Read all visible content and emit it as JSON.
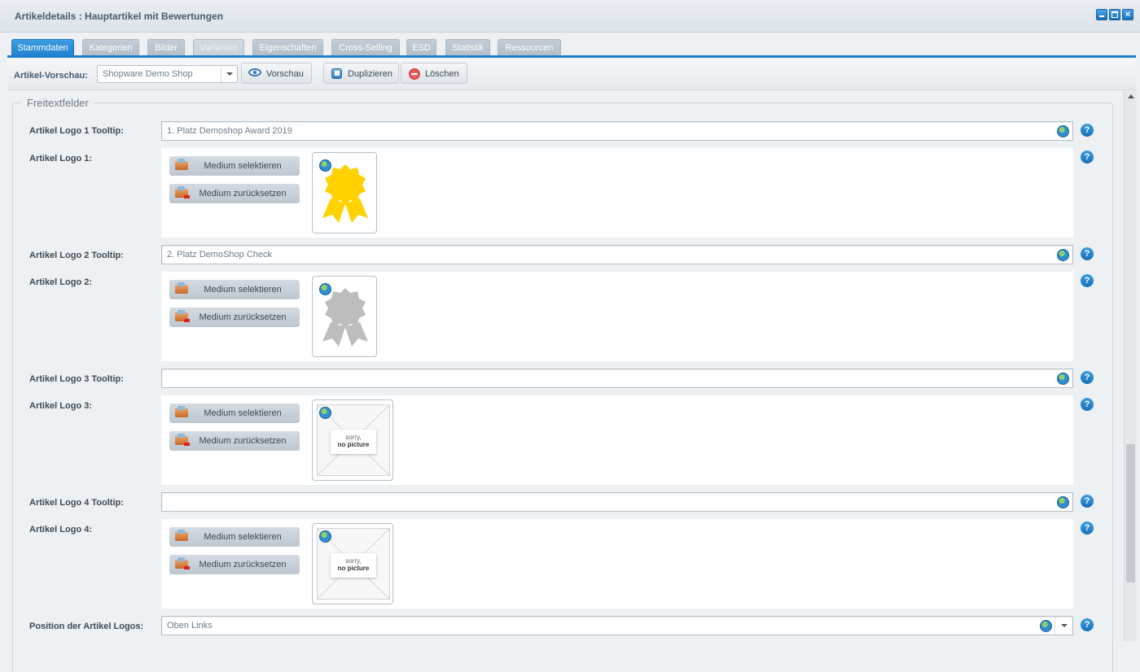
{
  "window": {
    "title": "Artikeldetails : Hauptartikel mit Bewertungen"
  },
  "tabs": [
    {
      "label": "Stammdaten",
      "state": "active"
    },
    {
      "label": "Kategorien",
      "state": "normal"
    },
    {
      "label": "Bilder",
      "state": "normal"
    },
    {
      "label": "Varianten",
      "state": "disabled"
    },
    {
      "label": "Eigenschaften",
      "state": "normal"
    },
    {
      "label": "Cross-Selling",
      "state": "normal"
    },
    {
      "label": "ESD",
      "state": "normal"
    },
    {
      "label": "Statistik",
      "state": "normal"
    },
    {
      "label": "Ressourcen",
      "state": "normal"
    }
  ],
  "toolbar": {
    "preview_label": "Artikel-Vorschau:",
    "shop_select": "Shopware Demo Shop",
    "preview_button": "Vorschau",
    "duplicate_button": "Duplizieren",
    "delete_button": "Löschen"
  },
  "fieldset": {
    "legend": "Freitextfelder"
  },
  "media_buttons": {
    "select": "Medium selektieren",
    "reset": "Medium zurücksetzen"
  },
  "nopicture": {
    "line1": "sorry,",
    "line2": "no picture"
  },
  "fields": {
    "logo1_tooltip": {
      "label": "Artikel Logo 1 Tooltip:",
      "value": "1. Platz Demoshop Award 2019"
    },
    "logo1": {
      "label": "Artikel Logo 1:",
      "image": "gold-badge"
    },
    "logo2_tooltip": {
      "label": "Artikel Logo 2 Tooltip:",
      "value": "2. Platz DemoShop Check"
    },
    "logo2": {
      "label": "Artikel Logo 2:",
      "image": "silver-badge"
    },
    "logo3_tooltip": {
      "label": "Artikel Logo 3 Tooltip:",
      "value": ""
    },
    "logo3": {
      "label": "Artikel Logo 3:",
      "image": "no-picture"
    },
    "logo4_tooltip": {
      "label": "Artikel Logo 4 Tooltip:",
      "value": ""
    },
    "logo4": {
      "label": "Artikel Logo 4:",
      "image": "no-picture"
    },
    "position": {
      "label": "Position der Artikel Logos:",
      "value": "Oben Links"
    }
  },
  "help_glyph": "?",
  "colors": {
    "accent": "#1f80cf",
    "gold_badge": "#ffd200",
    "silver_badge": "#bdbdbd"
  }
}
